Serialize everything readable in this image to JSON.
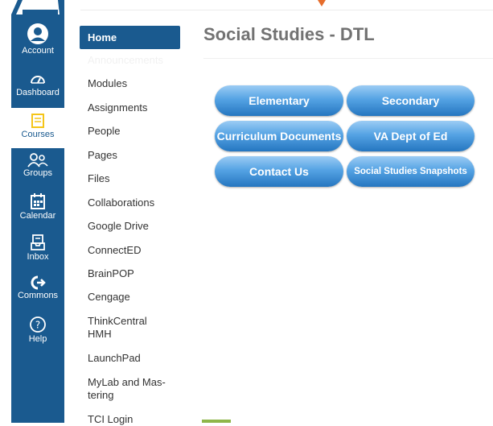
{
  "global_nav": {
    "items": [
      {
        "label": "Account",
        "icon": "account-icon"
      },
      {
        "label": "Dashboard",
        "icon": "dashboard-icon"
      },
      {
        "label": "Courses",
        "icon": "courses-icon"
      },
      {
        "label": "Groups",
        "icon": "groups-icon"
      },
      {
        "label": "Calendar",
        "icon": "calendar-icon"
      },
      {
        "label": "Inbox",
        "icon": "inbox-icon"
      },
      {
        "label": "Commons",
        "icon": "commons-icon"
      },
      {
        "label": "Help",
        "icon": "help-icon"
      }
    ],
    "active": "Courses",
    "colors": {
      "background": "#1a5a8f",
      "active_background": "#ffffff",
      "accent": "#e66d2c"
    }
  },
  "course_nav": {
    "items": [
      {
        "label": "Home",
        "active": true
      },
      {
        "label": "Announcements",
        "hidden": true
      },
      {
        "label": "Modules"
      },
      {
        "label": "Assignments"
      },
      {
        "label": "People"
      },
      {
        "label": "Pages"
      },
      {
        "label": "Files"
      },
      {
        "label": "Collaborations"
      },
      {
        "label": "Google Drive"
      },
      {
        "label": "ConnectED"
      },
      {
        "label": "BrainPOP"
      },
      {
        "label": "Cengage"
      },
      {
        "label": "ThinkCentral HMH"
      },
      {
        "label": "LaunchPad"
      },
      {
        "label": "MyLab and Mas-tering"
      },
      {
        "label": "TCI Login"
      }
    ]
  },
  "page": {
    "title": "Social Studies - DTL"
  },
  "buttons": [
    {
      "label": "Elementary"
    },
    {
      "label": "Secondary"
    },
    {
      "label": "Curriculum Documents"
    },
    {
      "label": "VA Dept of Ed"
    },
    {
      "label": "Contact Us"
    },
    {
      "label": "Social Studies Snapshots"
    }
  ]
}
